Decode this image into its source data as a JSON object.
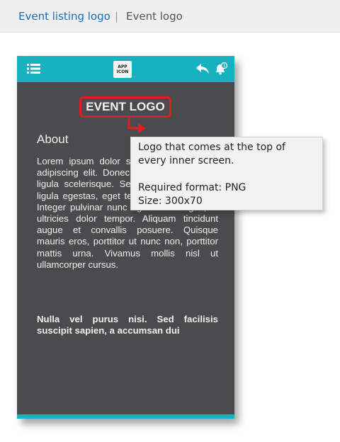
{
  "breadcrumb": {
    "link": "Event listing logo",
    "separator": "|",
    "current": "Event logo"
  },
  "app_header": {
    "app_icon_line1": "APP",
    "app_icon_line2": "ICON",
    "icons": [
      "menu-icon",
      "reply-icon",
      "bell-icon"
    ]
  },
  "content": {
    "event_logo": "EVENT LOGO",
    "about": "About",
    "lorem": "Lorem ipsum dolor sit amet, consectetur adipiscing elit. Donec consectetur ante in ligula scelerisque. Sed in turpis sit amet ligula egestas, eget tempus quam sagittis. Integer pulvinar nunc eget sem feugiat, ut ultricies dolor tempor. Aliquam tincidunt augue et convallis posuere. Quisque mauris eros, porttitor ut nunc non, porttitor mattis urna. Vivamus mollis nisl ut ullamcorper cursus.",
    "bold_paragraph": "Nulla vel purus nisi. Sed facilisis suscipit sapien, a accumsan dui"
  },
  "tooltip": {
    "line1": "Logo that comes at the top of",
    "line2": "every inner screen.",
    "format": "Required format: PNG",
    "size": "Size: 300x70"
  },
  "colors": {
    "accent": "#17b1c0",
    "phone_bg": "#4b4b4d",
    "highlight": "#e11b22",
    "link": "#1a6fb5"
  }
}
